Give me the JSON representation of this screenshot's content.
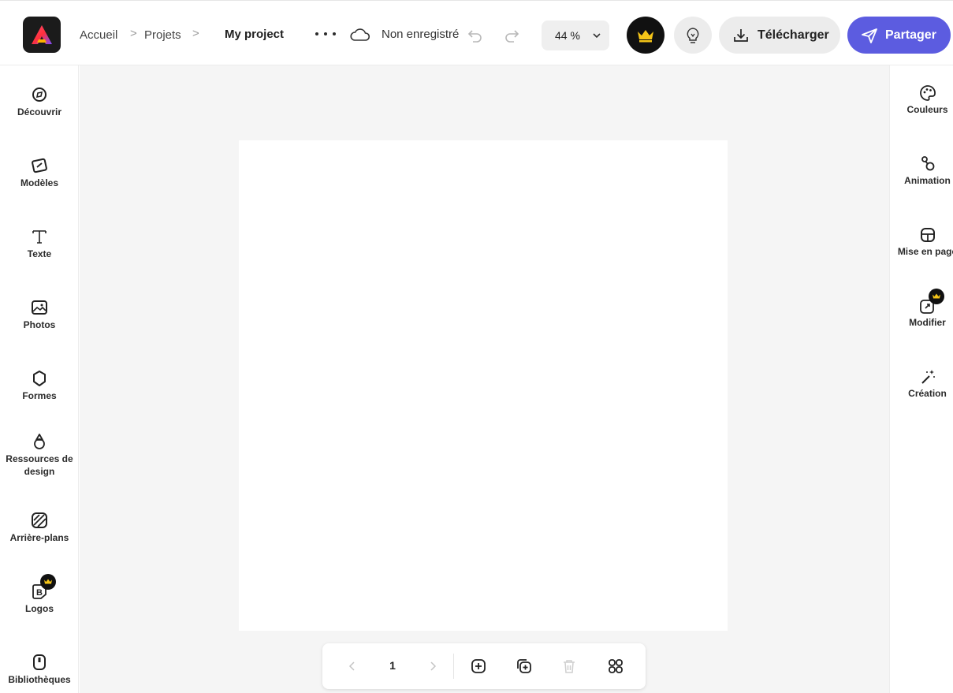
{
  "header": {
    "app_logo_letter": "A",
    "breadcrumbs": [
      "Accueil",
      "Projets"
    ],
    "breadcrumb_separator": ">",
    "project_title": "My project",
    "save_status": "Non enregistré",
    "zoom": "44 %",
    "download_label": "Télécharger",
    "share_label": "Partager",
    "accent_color": "#5c5ce0",
    "premium_color": "#f5c518"
  },
  "left_sidebar": {
    "items": [
      {
        "label": "Découvrir",
        "icon": "compass-icon"
      },
      {
        "label": "Modèles",
        "icon": "templates-icon"
      },
      {
        "label": "Texte",
        "icon": "text-icon"
      },
      {
        "label": "Photos",
        "icon": "photos-icon"
      },
      {
        "label": "Formes",
        "icon": "shapes-icon"
      },
      {
        "label": "Ressources de design",
        "icon": "design-assets-icon"
      },
      {
        "label": "Arrière-plans",
        "icon": "backgrounds-icon"
      },
      {
        "label": "Logos",
        "icon": "logos-icon",
        "premium": true
      },
      {
        "label": "Bibliothèques",
        "icon": "libraries-icon"
      }
    ]
  },
  "right_sidebar": {
    "items": [
      {
        "label": "Couleurs",
        "icon": "palette-icon"
      },
      {
        "label": "Animation",
        "icon": "animation-icon"
      },
      {
        "label": "Mise en page",
        "icon": "layout-icon"
      },
      {
        "label": "Modifier",
        "icon": "resize-icon",
        "premium": true
      },
      {
        "label": "Création",
        "icon": "magic-wand-icon"
      }
    ]
  },
  "page_toolbar": {
    "current_page": "1"
  }
}
